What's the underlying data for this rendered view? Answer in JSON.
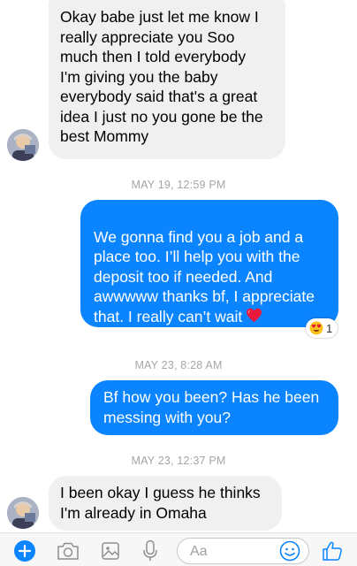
{
  "conversation": {
    "messages": [
      {
        "direction": "incoming",
        "text": "Okay babe just let me know I\nreally appreciate you Soo\nmuch then I told everybody\nI'm giving you the baby\neverybody said that's a great\nidea I just no you gone be the\nbest Mommy"
      },
      {
        "direction": "outgoing",
        "text": "We gonna find you a job and a\nplace too. I’ll help you with the\ndeposit too if needed. And\nawwwww thanks bf, I appreciate\nthat. I really can’t wait",
        "emoji": "heart",
        "reaction": {
          "emoji": "heart-eyes",
          "count": "1"
        }
      },
      {
        "direction": "outgoing",
        "text": "Bf how you been? Has he been\nmessing with you?"
      },
      {
        "direction": "incoming",
        "text": "I been okay I guess he thinks\nI'm already in Omaha"
      }
    ],
    "timestamps": [
      "MAY 19, 12:59 PM",
      "MAY 23, 8:28 AM",
      "MAY 23, 12:37 PM"
    ]
  },
  "composer": {
    "placeholder": "Aa",
    "icons": [
      "add-icon",
      "camera-icon",
      "gallery-icon",
      "microphone-icon",
      "emoji-icon",
      "like-icon"
    ],
    "accent_color": "#0a84ff"
  },
  "colors": {
    "outgoing_bubble": "#0a84ff",
    "incoming_bubble": "#f0f0f0",
    "timestamp": "#a6a6aa"
  }
}
